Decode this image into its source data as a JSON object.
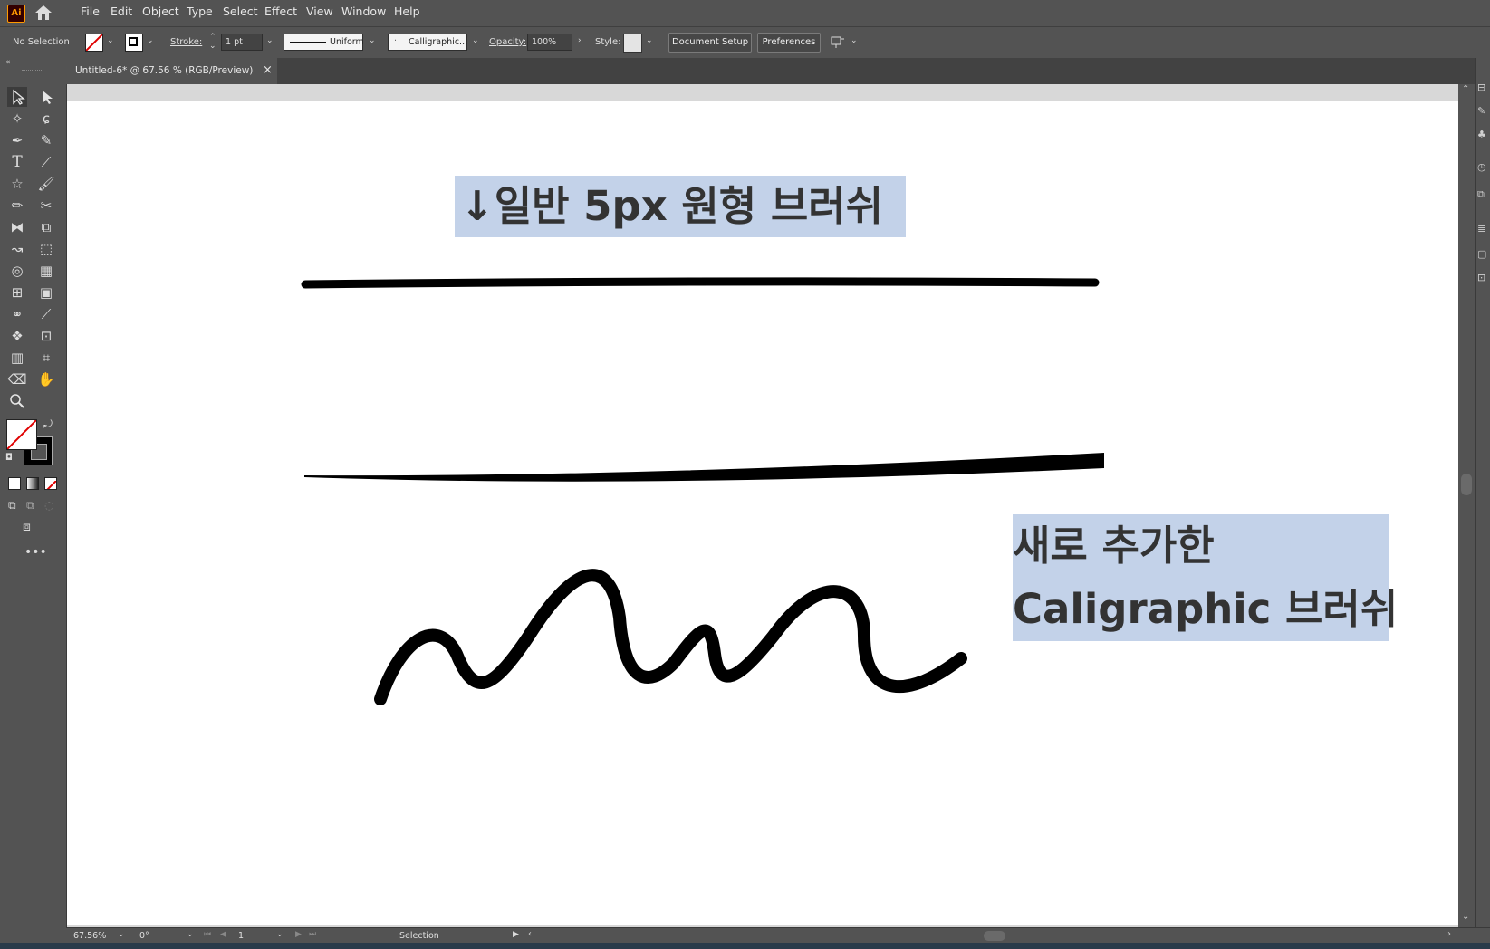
{
  "app": {
    "logo": "Ai"
  },
  "menu": [
    "File",
    "Edit",
    "Object",
    "Type",
    "Select",
    "Effect",
    "View",
    "Window",
    "Help"
  ],
  "control_bar": {
    "selection_status": "No Selection",
    "stroke_label": "Stroke:",
    "stroke_weight": "1 pt",
    "stroke_profile": "Uniform",
    "brush": "Calligraphic...",
    "opacity_label": "Opacity:",
    "opacity_value": "100%",
    "style_label": "Style:",
    "document_setup": "Document Setup",
    "preferences": "Preferences"
  },
  "document_tab": {
    "title": "Untitled-6* @ 67.56 % (RGB/Preview)",
    "close": "×"
  },
  "artboard": {
    "label_top": "↓일반 5px 원형 브러쉬",
    "label_right_line1": "새로 추가한",
    "label_right_line2": "Caligraphic 브러쉬"
  },
  "status_bar": {
    "zoom": "67.56%",
    "rotation": "0°",
    "artboard_number": "1",
    "current_tool": "Selection"
  },
  "colors": {
    "ui_dark": "#535353",
    "highlight": "#c3d2e9",
    "stroke": "#000000",
    "logo_bg": "#330000",
    "logo_fg": "#ff9a00"
  }
}
